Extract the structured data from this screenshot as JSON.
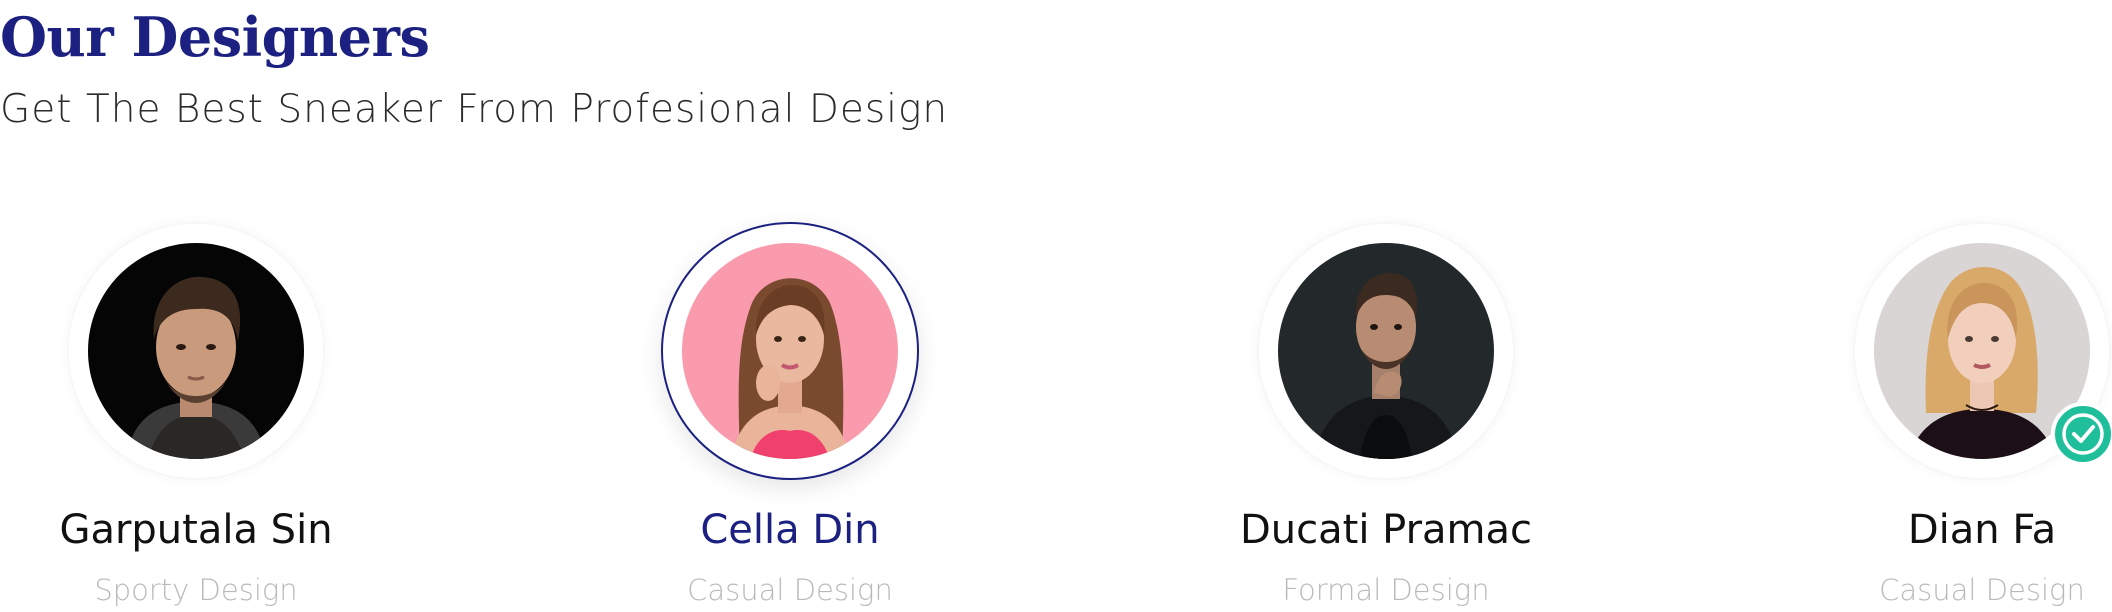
{
  "section": {
    "title": "Our Designers",
    "subtitle": "Get The Best Sneaker From Profesional Design"
  },
  "colors": {
    "brand": "#1c2181",
    "verified": "#1fbf9b",
    "name_text": "#111111",
    "role_text": "#b9b9b9"
  },
  "designers": [
    {
      "name": "Garputala Sin",
      "role": "Sporty Design",
      "selected": false,
      "verified": false,
      "avatar_icon": "man-with-curly-hair-portrait"
    },
    {
      "name": "Cella Din",
      "role": "Casual Design",
      "selected": true,
      "verified": false,
      "avatar_icon": "woman-long-hair-pink-background-portrait"
    },
    {
      "name": "Ducati Pramac",
      "role": "Formal Design",
      "selected": false,
      "verified": false,
      "avatar_icon": "man-thinking-dark-background-portrait"
    },
    {
      "name": "Dian Fa",
      "role": "Casual Design",
      "selected": false,
      "verified": true,
      "avatar_icon": "woman-blonde-hair-portrait"
    }
  ]
}
